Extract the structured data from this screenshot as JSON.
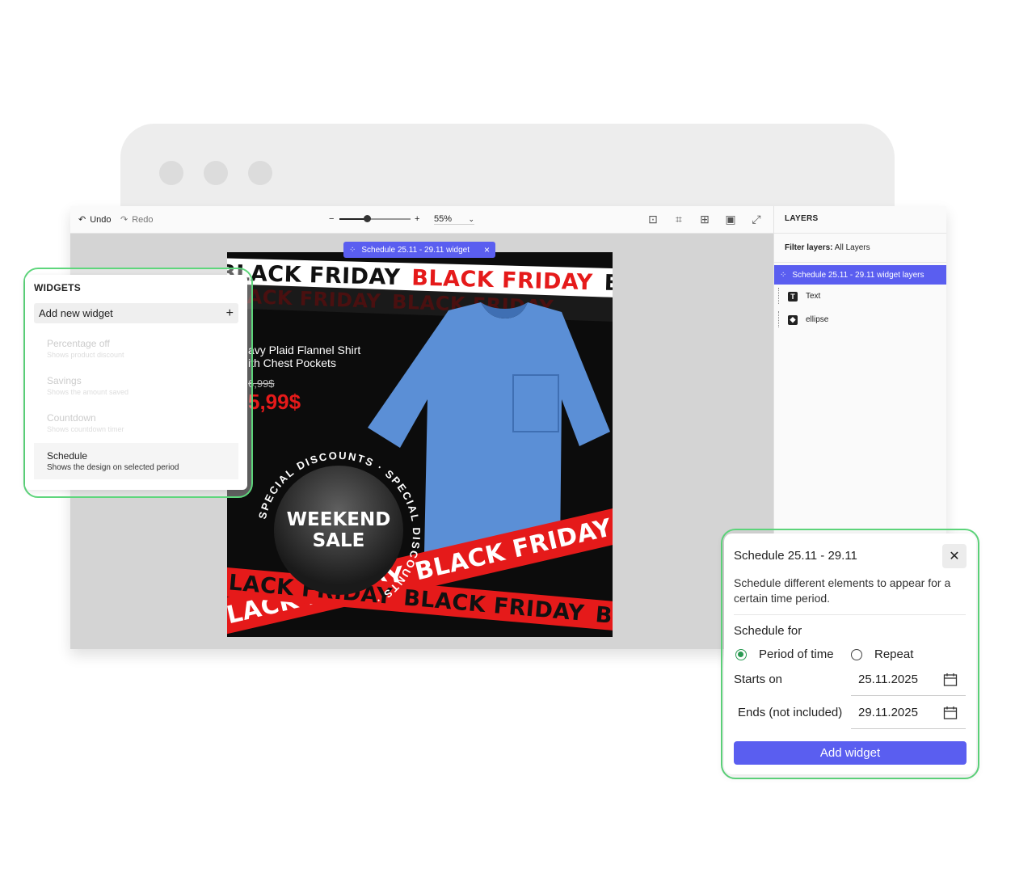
{
  "toolbar": {
    "undo_label": "Undo",
    "redo_label": "Redo",
    "zoom_minus": "−",
    "zoom_plus": "+",
    "zoom_value": "55%",
    "zoom_level_fraction": 0.38
  },
  "layers": {
    "heading": "LAYERS",
    "filter_label": "Filter layers:",
    "filter_value": "All Layers",
    "items": [
      {
        "label": "Schedule 25.11 - 29.11 widget layers"
      },
      {
        "label": "Text"
      },
      {
        "label": "ellipse"
      }
    ]
  },
  "canvas": {
    "widget_tag": "Schedule 25.11 - 29.11 widget",
    "tape_text": "BLACK FRIDAY",
    "product_title_line1": "avy Plaid Flannel Shirt",
    "product_title_line2": "ith Chest Pockets",
    "old_price": "6,99$",
    "new_price": "5,99$",
    "badge_line1": "WEEKEND",
    "badge_line2": "SALE",
    "ring_text": "SPECIAL DISCOUNTS · SPECIAL DISCOUNTS ·"
  },
  "widgets": {
    "heading": "WIDGETS",
    "add_new": "Add new widget",
    "items": [
      {
        "title": "Percentage off",
        "desc": "Shows product discount"
      },
      {
        "title": "Savings",
        "desc": "Shows the amount saved"
      },
      {
        "title": "Countdown",
        "desc": "Shows countdown timer"
      },
      {
        "title": "Schedule",
        "desc": "Shows the design on selected period"
      }
    ]
  },
  "schedule": {
    "title": "Schedule 25.11 - 29.11",
    "description": "Schedule different elements to appear for a certain time period.",
    "schedule_for": "Schedule for",
    "option_period": "Period of time",
    "option_repeat": "Repeat",
    "selected_option": "Period of time",
    "starts_label": "Starts on",
    "starts_value": "25.11.2025",
    "ends_label": "Ends (not included)",
    "ends_value": "29.11.2025",
    "add_button": "Add widget"
  },
  "colors": {
    "accent": "#5a5ef0",
    "highlight_outline": "#5ed67c",
    "sale_red": "#e51a1a",
    "radio_green": "#2a9a52"
  }
}
